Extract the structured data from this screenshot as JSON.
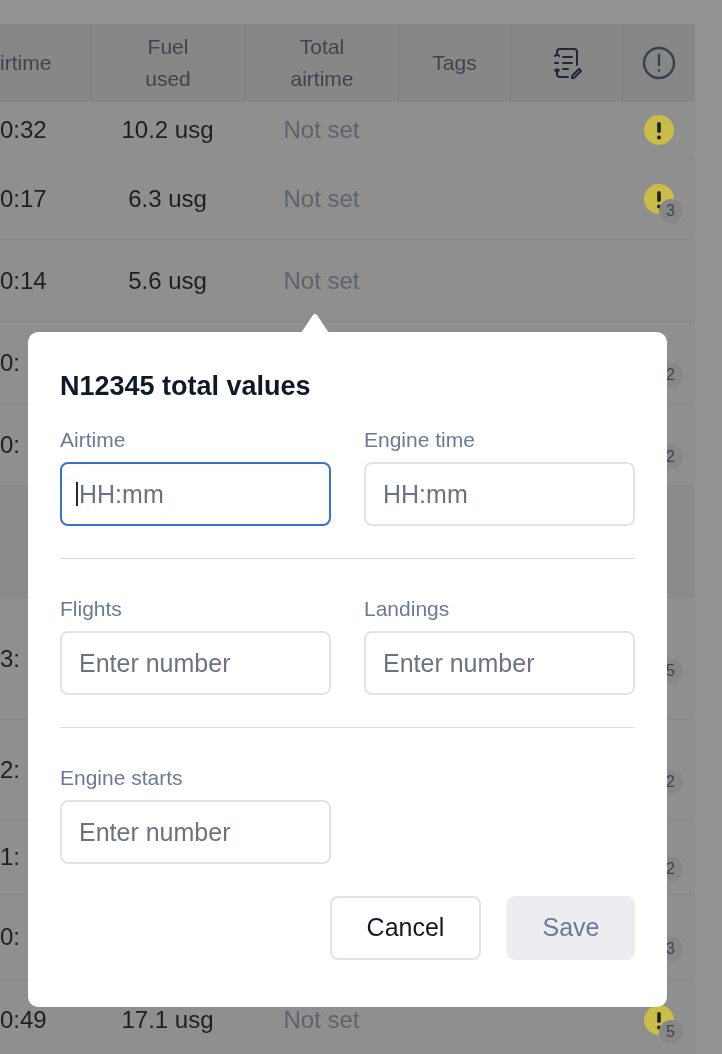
{
  "table": {
    "columns": [
      {
        "kind": "text",
        "label": "irtime"
      },
      {
        "kind": "text",
        "label": "Fuel used"
      },
      {
        "kind": "text",
        "label": "Total airtime"
      },
      {
        "kind": "text",
        "label": "Tags"
      },
      {
        "kind": "notes-icon"
      },
      {
        "kind": "alert-icon"
      }
    ],
    "rows": [
      {
        "kind": "flight",
        "airtime": "0:32",
        "fuel": "10.2 usg",
        "total": "Not set",
        "alert": {
          "color": "#c9bd48"
        }
      },
      {
        "kind": "flight",
        "airtime": "0:17",
        "fuel": "6.3 usg",
        "total": "Not set",
        "alert": {
          "color": "#c9bd48",
          "count": "3"
        }
      },
      {
        "kind": "flight",
        "airtime": "0:14",
        "fuel": "5.6 usg",
        "total": "Not set"
      },
      {
        "kind": "flight",
        "airtime": "0:",
        "alert": {
          "count": "2"
        }
      },
      {
        "kind": "flight",
        "airtime": "0:",
        "alert": {
          "count": "2"
        }
      },
      {
        "kind": "group"
      },
      {
        "kind": "flight",
        "airtime": "3:",
        "alert": {
          "count": "5"
        }
      },
      {
        "kind": "flight",
        "airtime": "2:",
        "alert": {
          "count": "2"
        }
      },
      {
        "kind": "flight",
        "airtime": "1:",
        "alert": {
          "count": "2"
        }
      },
      {
        "kind": "flight",
        "airtime": "0:",
        "alert": {
          "count": "3"
        }
      },
      {
        "kind": "flight",
        "airtime": "0:49",
        "fuel": "17.1 usg",
        "total": "Not set",
        "alert": {
          "color": "#c9bd48",
          "count": "5"
        }
      }
    ]
  },
  "dialog": {
    "title": "N12345 total values",
    "sections": [
      {
        "fields": [
          {
            "label": "Airtime",
            "placeholder": "HH:mm",
            "focused": true
          },
          {
            "label": "Engine time",
            "placeholder": "HH:mm",
            "focused": false
          }
        ]
      },
      {
        "fields": [
          {
            "label": "Flights",
            "placeholder": "Enter number",
            "focused": false
          },
          {
            "label": "Landings",
            "placeholder": "Enter number",
            "focused": false
          }
        ]
      },
      {
        "fields": [
          {
            "label": "Engine starts",
            "placeholder": "Enter number",
            "focused": false
          }
        ]
      }
    ],
    "buttons": [
      {
        "label": "Cancel",
        "disabled": false
      },
      {
        "label": "Save",
        "disabled": true
      }
    ]
  }
}
